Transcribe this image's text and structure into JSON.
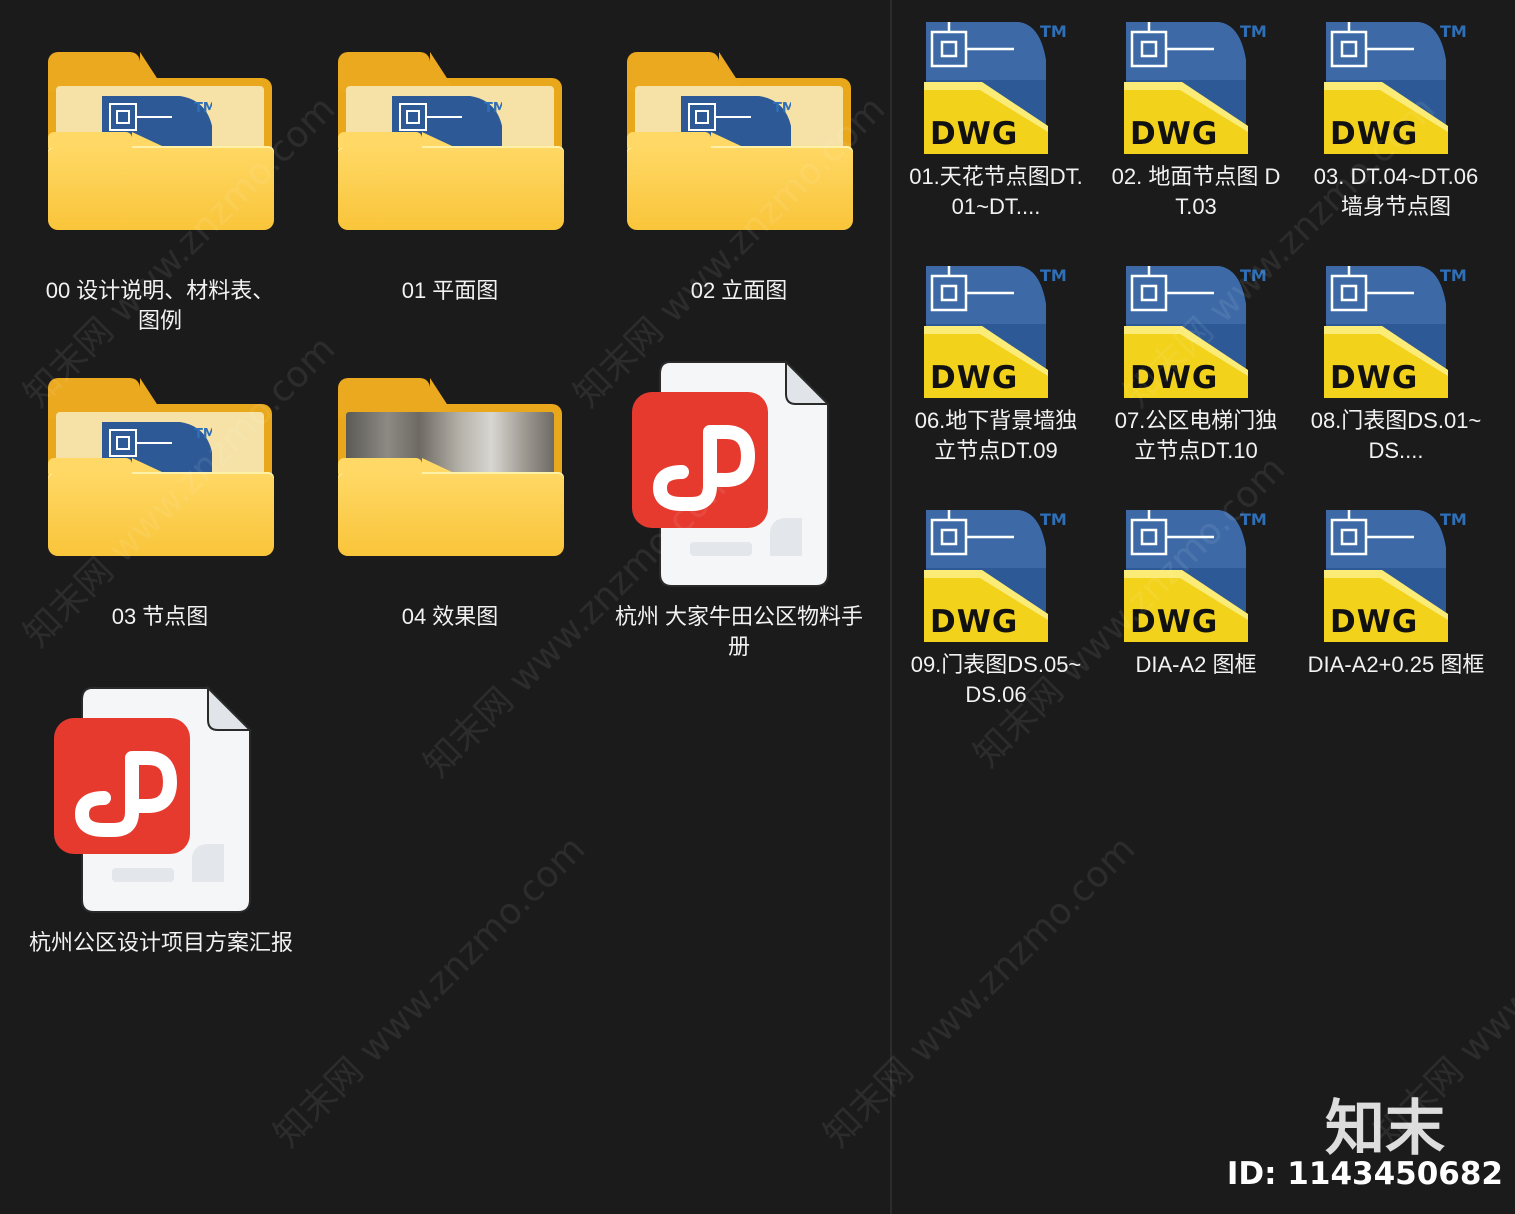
{
  "left_pane": {
    "items": [
      {
        "type": "folder",
        "label": "00  设计说明、材料表、图例"
      },
      {
        "type": "folder",
        "label": "01 平面图"
      },
      {
        "type": "folder",
        "label": "02 立面图"
      },
      {
        "type": "folder",
        "label": "03 节点图"
      },
      {
        "type": "folder-photo",
        "label": "04 效果图"
      },
      {
        "type": "pdf",
        "label": "杭州 大家牛田公区物料手册"
      },
      {
        "type": "pdf",
        "label": "杭州公区设计项目方案汇报"
      }
    ]
  },
  "right_pane": {
    "items": [
      {
        "type": "dwg",
        "label": "01.天花节点图DT.01~DT...."
      },
      {
        "type": "dwg",
        "label": "02. 地面节点图 DT.03"
      },
      {
        "type": "dwg",
        "label": "03. DT.04~DT.06墙身节点图"
      },
      {
        "type": "dwg",
        "label": "06.地下背景墙独立节点DT.09"
      },
      {
        "type": "dwg",
        "label": "07.公区电梯门独立节点DT.10"
      },
      {
        "type": "dwg",
        "label": "08.门表图DS.01~DS...."
      },
      {
        "type": "dwg",
        "label": "09.门表图DS.05~DS.06"
      },
      {
        "type": "dwg",
        "label": "DIA-A2 图框"
      },
      {
        "type": "dwg",
        "label": "DIA-A2+0.25 图框"
      }
    ]
  },
  "icons": {
    "dwg_badge": "DWG",
    "trademark": "TM",
    "folder_icon": "folder-icon",
    "pdf_icon": "pdf-icon"
  },
  "watermark": {
    "text": "知末网 www.znzmo.com",
    "logo": "知末",
    "id": "ID: 1143450682"
  },
  "colors": {
    "background": "#1b1b1b",
    "folder": "#f9c53a",
    "pdf_red": "#e83a30",
    "dwg_yellow": "#f2d21b",
    "dwg_blue": "#2d5a96"
  }
}
